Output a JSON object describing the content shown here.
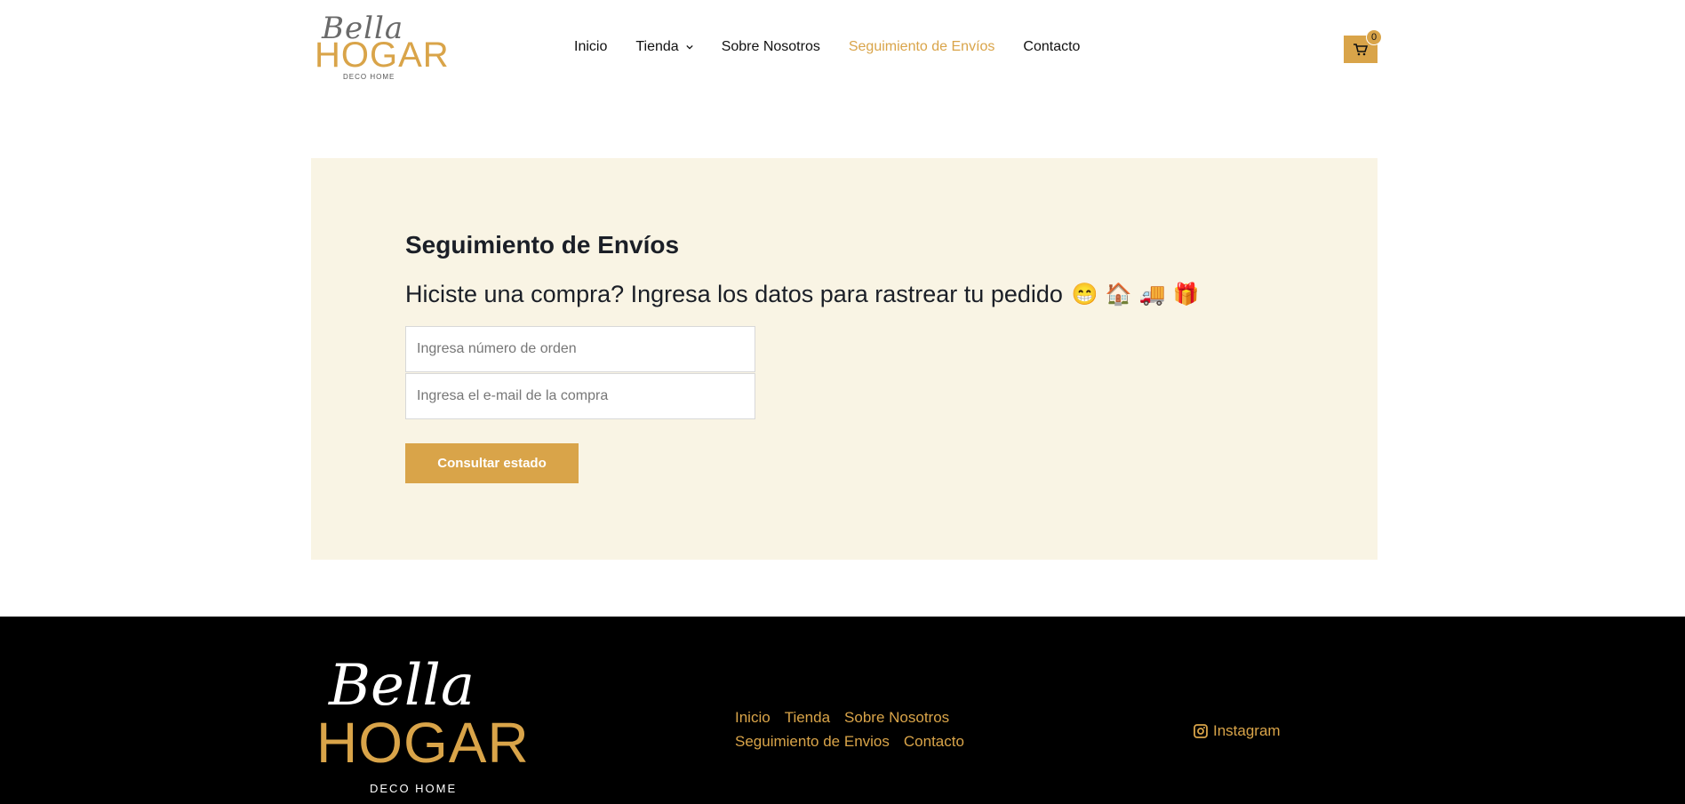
{
  "brand": {
    "script": "Bella",
    "word": "HOGAR",
    "sub": "DECO HOME"
  },
  "nav": {
    "items": [
      {
        "label": "Inicio"
      },
      {
        "label": "Tienda"
      },
      {
        "label": "Sobre Nosotros"
      },
      {
        "label": "Seguimiento de Envíos"
      },
      {
        "label": "Contacto"
      }
    ]
  },
  "cart": {
    "count": "0"
  },
  "tracking": {
    "title": "Seguimiento de Envíos",
    "subtitle": "Hiciste una compra? Ingresa los datos para rastrear tu pedido",
    "emojis": [
      "😁",
      "🏠",
      "🚚",
      "🎁"
    ],
    "order_placeholder": "Ingresa número de orden",
    "email_placeholder": "Ingresa el e-mail de la compra",
    "button": "Consultar estado"
  },
  "footer": {
    "brand": {
      "script": "Bella",
      "word": "HOGAR",
      "sub": "DECO HOME"
    },
    "links_row1": [
      {
        "label": "Inicio"
      },
      {
        "label": "Tienda"
      },
      {
        "label": "Sobre Nosotros"
      }
    ],
    "links_row2": [
      {
        "label": "Seguimiento de Envios"
      },
      {
        "label": "Contacto"
      }
    ],
    "social": {
      "label": "Instagram"
    }
  }
}
